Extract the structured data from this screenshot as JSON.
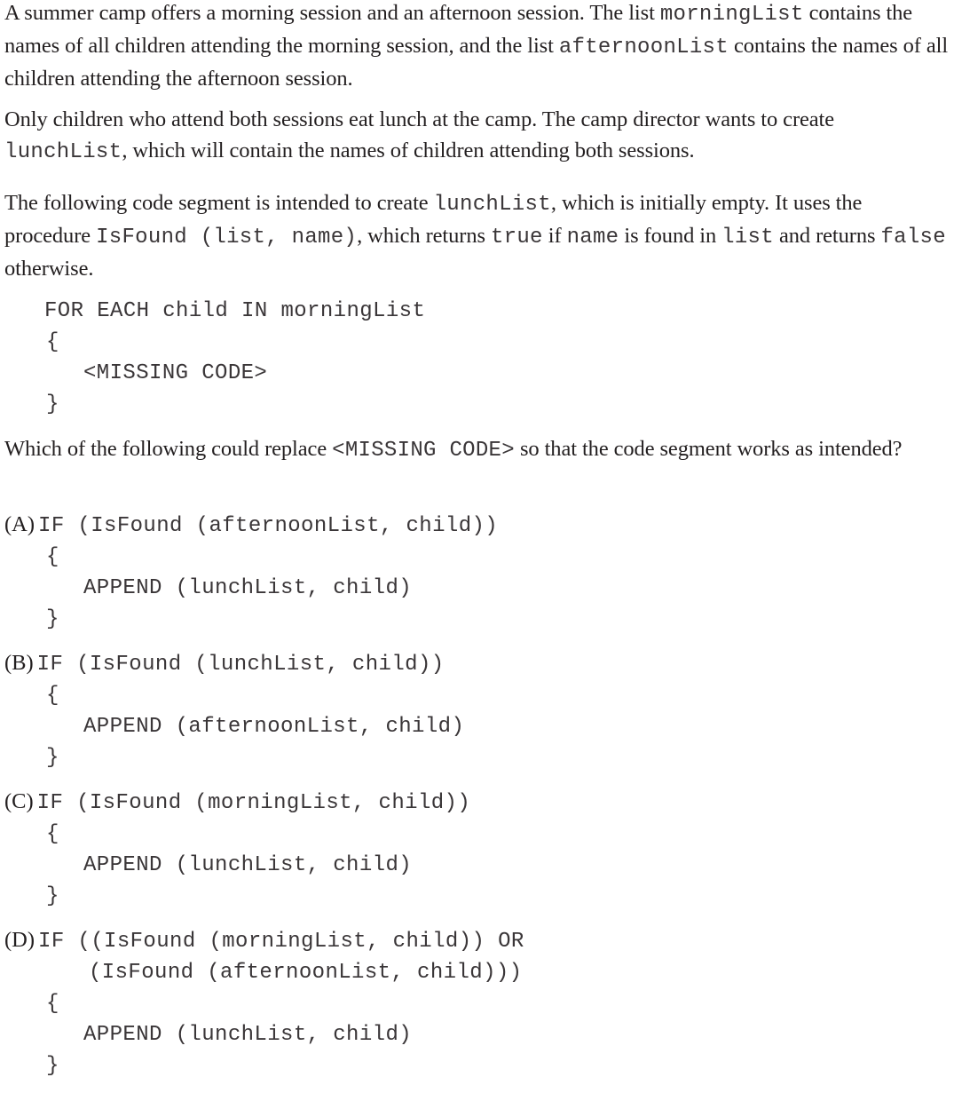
{
  "intro": {
    "p1": {
      "t1": "A summer camp offers a morning session and an afternoon session. The list ",
      "c1": "morningList",
      "t2": " contains the names of all children attending the morning session, and the list ",
      "c2": "afternoonList",
      "t3": " contains the names of all children attending the afternoon session."
    },
    "p2": {
      "t1": "Only children who attend both sessions eat lunch at the camp. The camp director wants to create ",
      "c1": "lunchList",
      "t2": ", which will contain the names of children attending both sessions."
    },
    "p3": {
      "t1": "The following code segment is intended to create ",
      "c1": "lunchList",
      "t2": ", which is initially empty. It uses the procedure ",
      "c2": "IsFound (list, name)",
      "t3": ", which returns ",
      "c3": "true",
      "t4": " if ",
      "c4": "name",
      "t5": " is found in ",
      "c5": "list",
      "t6": " and returns ",
      "c6": "false",
      "t7": " otherwise."
    }
  },
  "code_segment": {
    "line1": "FOR EACH child IN morningList",
    "open": "{",
    "body": "<MISSING CODE>",
    "close": "}"
  },
  "question": {
    "t1": "Which of the following could replace ",
    "c1": "<MISSING CODE>",
    "t2": " so that the code segment works as intended?"
  },
  "options": [
    {
      "label": "(A)",
      "line1": "IF (IsFound (afternoonList, child))",
      "open": "{",
      "body": "APPEND (lunchList, child)",
      "close": "}"
    },
    {
      "label": "(B)",
      "line1": "IF (IsFound (lunchList, child))",
      "open": "{",
      "body": "APPEND (afternoonList, child)",
      "close": "}"
    },
    {
      "label": "(C)",
      "line1": "IF (IsFound (morningList, child))",
      "open": "{",
      "body": "APPEND (lunchList, child)",
      "close": "}"
    },
    {
      "label": "(D)",
      "line1": "IF ((IsFound (morningList, child)) OR",
      "line2": "(IsFound (afternoonList, child)))",
      "open": "{",
      "body": "APPEND (lunchList, child)",
      "close": "}"
    }
  ]
}
